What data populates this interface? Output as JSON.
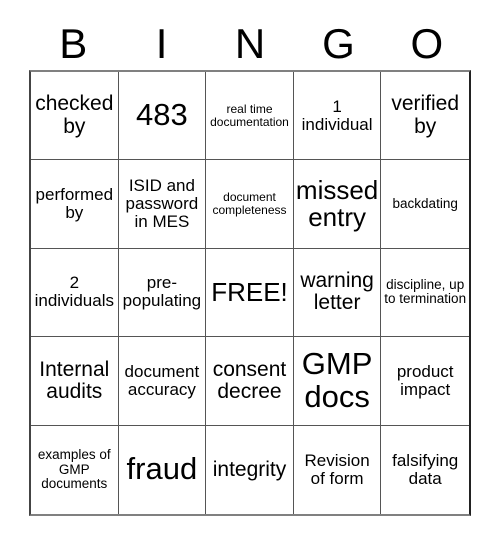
{
  "header": {
    "letters": [
      "B",
      "I",
      "N",
      "G",
      "O"
    ]
  },
  "grid": {
    "columns": 5,
    "rows": 5,
    "cells": [
      {
        "text": "checked by",
        "size": "md"
      },
      {
        "text": "483",
        "size": "xl"
      },
      {
        "text": "real time documentation",
        "size": "xxs"
      },
      {
        "text": "1 individual",
        "size": "sm"
      },
      {
        "text": "verified by",
        "size": "md"
      },
      {
        "text": "performed by",
        "size": "sm"
      },
      {
        "text": "ISID and password in MES",
        "size": "sm"
      },
      {
        "text": "document completeness",
        "size": "xxs"
      },
      {
        "text": "missed entry",
        "size": "lg"
      },
      {
        "text": "backdating",
        "size": "xs"
      },
      {
        "text": "2 individuals",
        "size": "sm"
      },
      {
        "text": "pre-populating",
        "size": "sm"
      },
      {
        "text": "FREE!",
        "size": "lg"
      },
      {
        "text": "warning letter",
        "size": "md"
      },
      {
        "text": "discipline, up to termination",
        "size": "xs"
      },
      {
        "text": "Internal audits",
        "size": "md"
      },
      {
        "text": "document accuracy",
        "size": "sm"
      },
      {
        "text": "consent decree",
        "size": "md"
      },
      {
        "text": "GMP docs",
        "size": "xl"
      },
      {
        "text": "product impact",
        "size": "sm"
      },
      {
        "text": "examples of GMP documents",
        "size": "xs"
      },
      {
        "text": "fraud",
        "size": "xl"
      },
      {
        "text": "integrity",
        "size": "md"
      },
      {
        "text": "Revision of form",
        "size": "sm"
      },
      {
        "text": "falsifying data",
        "size": "sm"
      }
    ]
  },
  "colors": {
    "background": "#ffffff",
    "text": "#000000",
    "grid_line": "#555555",
    "outer_border": "#444444"
  }
}
